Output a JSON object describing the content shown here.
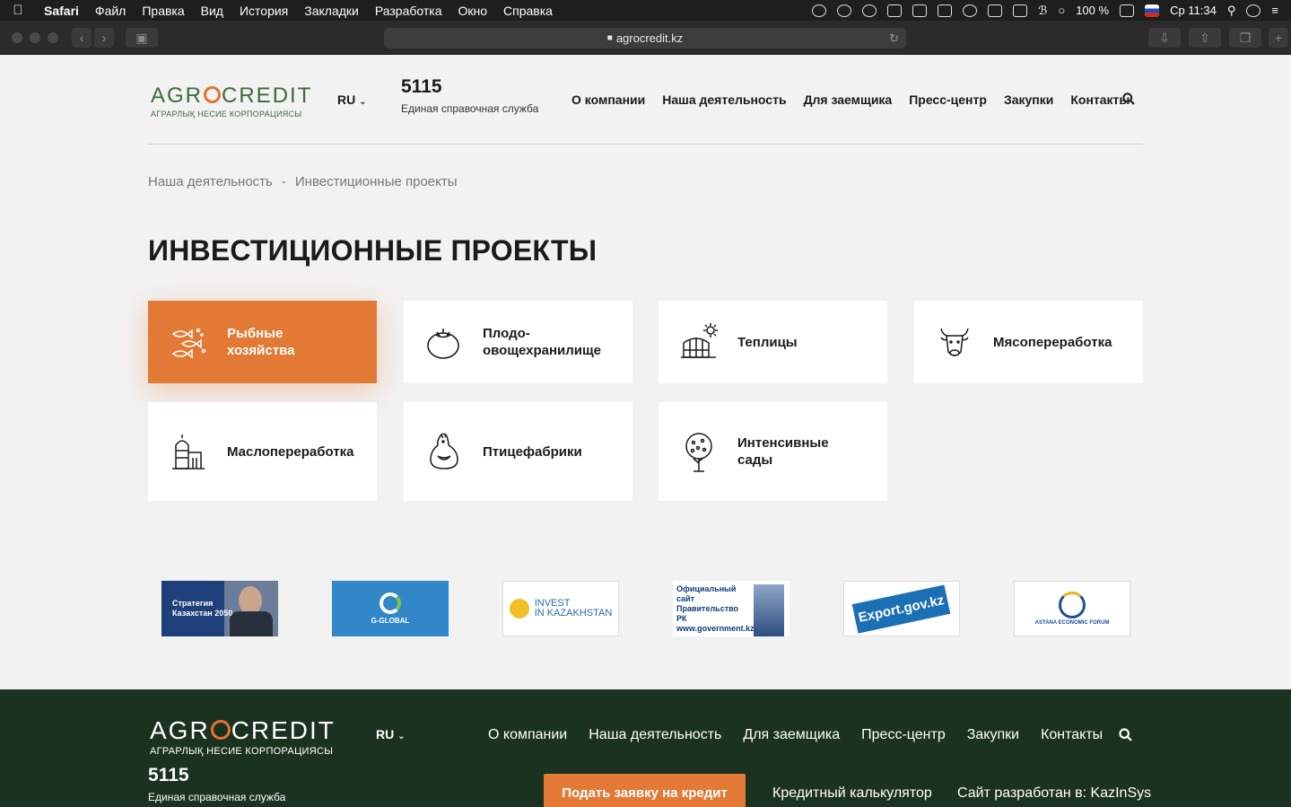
{
  "menubar": {
    "app": "Safari",
    "items": [
      "Файл",
      "Правка",
      "Вид",
      "История",
      "Закладки",
      "Разработка",
      "Окно",
      "Справка"
    ],
    "battery": "100 %",
    "clock": "Ср 11:34"
  },
  "browser": {
    "url": "agrocredit.kz"
  },
  "header": {
    "logo_word_left": "AGR",
    "logo_word_right": "CREDIT",
    "logo_subtitle": "АГРАРЛЫҚ НЕСИЕ КОРПОРАЦИЯСЫ",
    "lang": "RU",
    "phone": "5115",
    "phone_caption": "Единая справочная служба",
    "nav": [
      "О компании",
      "Наша деятельность",
      "Для заемщика",
      "Пресс-центр",
      "Закупки",
      "Контакты"
    ]
  },
  "breadcrumb": {
    "items": [
      "Наша деятельность",
      "Инвестиционные проекты"
    ],
    "separator": "-"
  },
  "page_title": "ИНВЕСТИЦИОННЫЕ ПРОЕКТЫ",
  "cards": [
    {
      "label": "Рыбные\nхозяйства",
      "icon": "fish-icon",
      "active": true
    },
    {
      "label": "Плодо-\nовощехранилище",
      "icon": "tomato-icon",
      "active": false
    },
    {
      "label": "Теплицы",
      "icon": "greenhouse-icon",
      "active": false
    },
    {
      "label": "Мясопереработка",
      "icon": "cow-icon",
      "active": false
    },
    {
      "label": "Маслопереработка",
      "icon": "silo-icon",
      "active": false
    },
    {
      "label": "Птицефабрики",
      "icon": "chicken-icon",
      "active": false
    },
    {
      "label": "Интенсивные\nсады",
      "icon": "tree-icon",
      "active": false
    }
  ],
  "partners": {
    "p1": "Стратегия\nКазахстан 2050",
    "p2": "G-GLOBAL",
    "p3": "INVEST\nIN KAZAKHSTAN",
    "p4": "Официальный сайт\nПравительство РК\nwww.government.kz",
    "p5": "Export.gov.kz",
    "p6": "ASTANA ECONOMIC FORUM"
  },
  "footer": {
    "lang": "RU",
    "nav": [
      "О компании",
      "Наша деятельность",
      "Для заемщика",
      "Пресс-центр",
      "Закупки",
      "Контакты"
    ],
    "phone": "5115",
    "phone_caption": "Единая справочная служба",
    "cta": "Подать заявку на кредит",
    "calculator": "Кредитный калькулятор",
    "developer": "Сайт разработан в: KazInSys"
  },
  "colors": {
    "accent": "#e27a35",
    "brand_green": "#3d6a3a",
    "footer_bg": "#1c3220"
  }
}
